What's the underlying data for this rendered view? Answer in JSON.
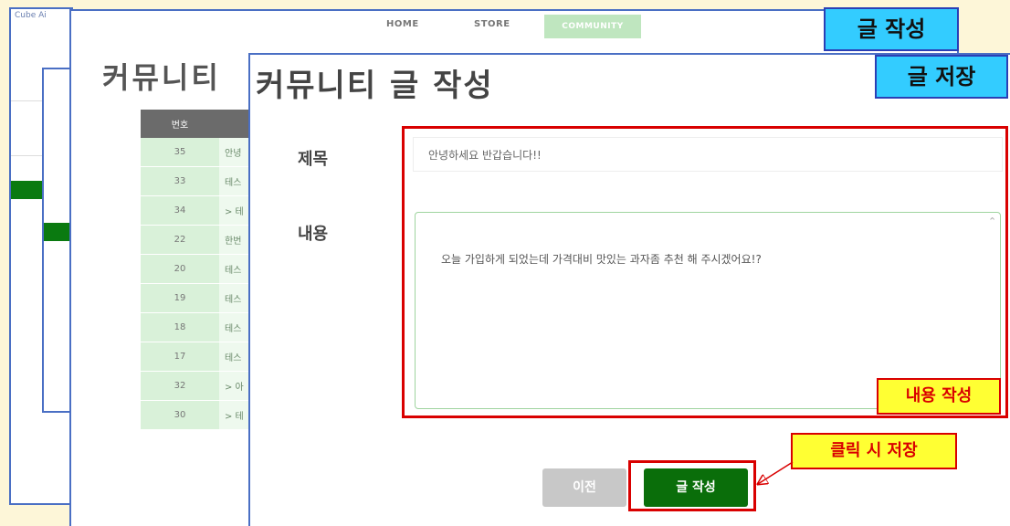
{
  "nav": {
    "home": "HOME",
    "store": "STORE",
    "community": "COMMUNITY"
  },
  "sidebar": {
    "brand": "Cube Ai"
  },
  "background": {
    "title": "커뮤니티",
    "table": {
      "header": [
        "번호",
        ""
      ],
      "rows": [
        {
          "num": "35",
          "title": "안녕"
        },
        {
          "num": "33",
          "title": "테스"
        },
        {
          "num": "34",
          "title": "> 테"
        },
        {
          "num": "22",
          "title": "한번"
        },
        {
          "num": "20",
          "title": "테스"
        },
        {
          "num": "19",
          "title": "테스"
        },
        {
          "num": "18",
          "title": "테스"
        },
        {
          "num": "17",
          "title": "테스"
        },
        {
          "num": "32",
          "title": "> 아"
        },
        {
          "num": "30",
          "title": "> 테"
        }
      ]
    }
  },
  "write": {
    "page_title": "커뮤니티 글 작성",
    "title_label": "제목",
    "content_label": "내용",
    "title_value": "안녕하세요 반갑습니다!!",
    "content_value": "오늘 가입하게 되었는데 가격대비 맛있는 과자좀 추천 해 주시겠어요!?",
    "prev_button": "이전",
    "submit_button": "글 작성"
  },
  "annotations": {
    "write_label": "글 작성",
    "save_label": "글 저장",
    "content_label": "내용 작성",
    "click_label": "클릭 시 저장"
  },
  "colors": {
    "accent_green": "#0a6e0a",
    "callout_blue": "#33ccff",
    "callout_yellow": "#ffff33",
    "annotation_red": "#d90000"
  }
}
